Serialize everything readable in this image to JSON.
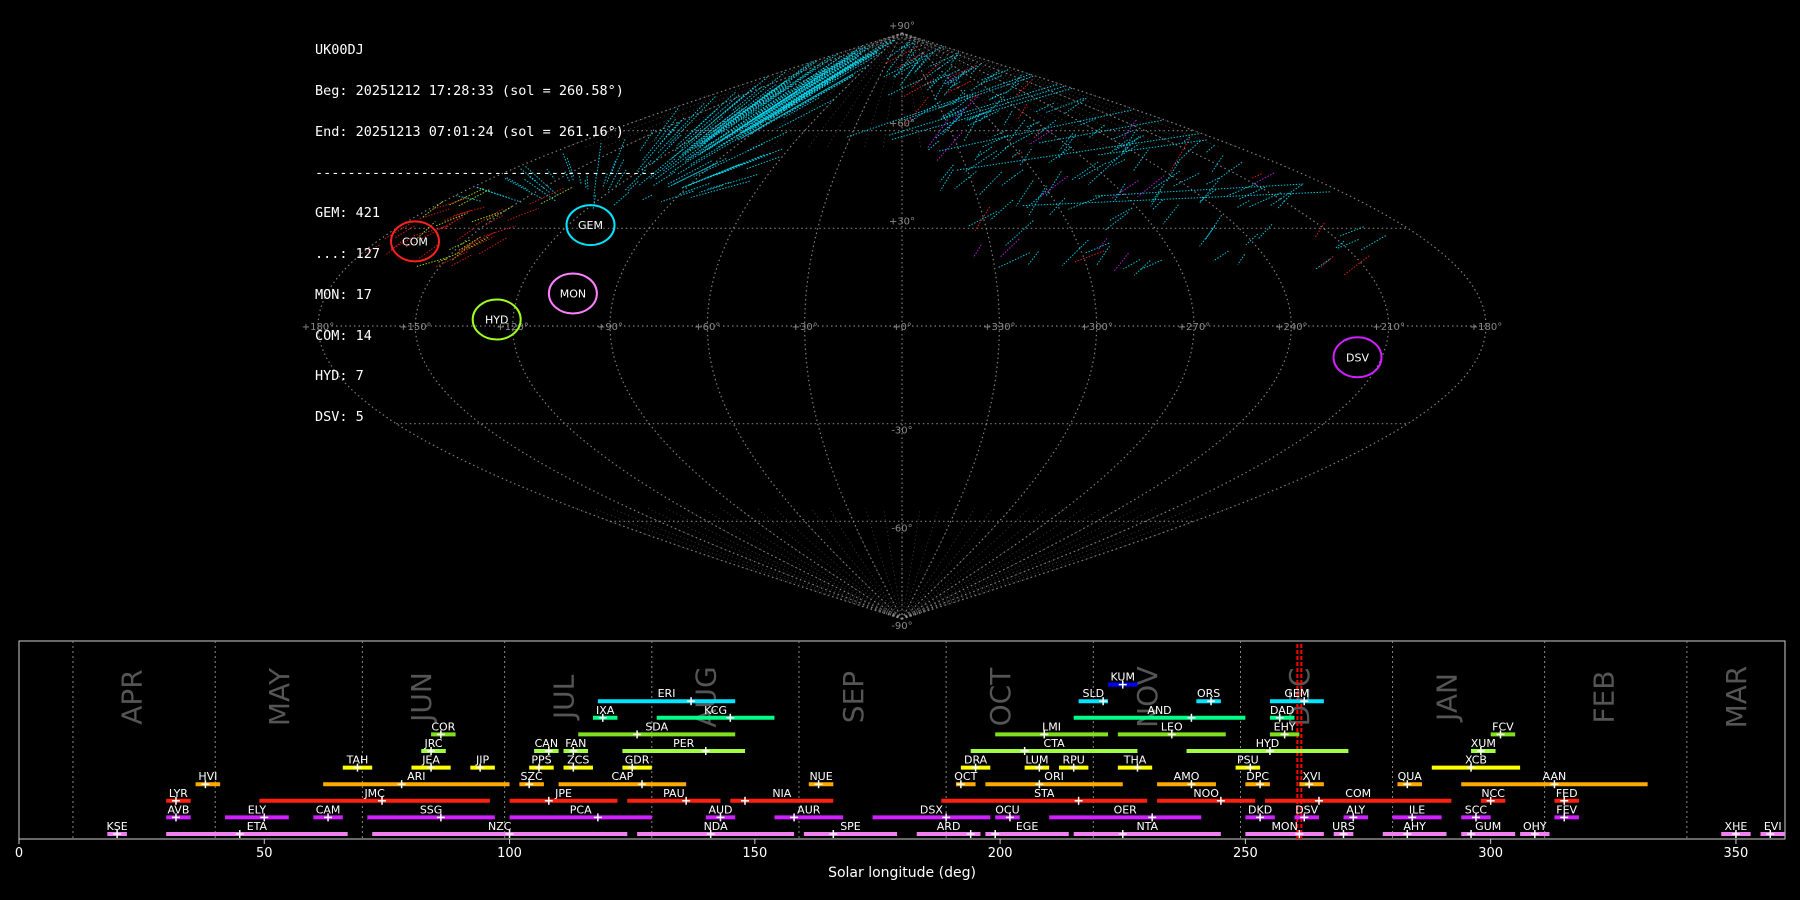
{
  "info": {
    "station": "UK00DJ",
    "begin": "Beg: 20251212 17:28:33 (sol = 260.58°)",
    "end": "End: 20251213 07:01:24 (sol = 261.16°)",
    "separator": "------------------------------------------",
    "counts": [
      "GEM: 421",
      "...: 127",
      "MON: 17",
      "COM: 14",
      "HYD: 7",
      "DSV: 5"
    ]
  },
  "colors": {
    "background": "#000000",
    "grid": "#9a9a9a",
    "sporadic": "#00e5ff",
    "marker": "#ff0000"
  },
  "chart_data": [
    {
      "type": "scatter",
      "projection": "sinusoidal",
      "ra_tick_labels": [
        "+180°",
        "+150°",
        "+120°",
        "+90°",
        "+60°",
        "+30°",
        "+0°",
        "+330°",
        "+300°",
        "+270°",
        "+240°",
        "+210°",
        "+180°"
      ],
      "dec_tick_labels": [
        "+90°",
        "+60°",
        "+30°",
        "-30°",
        "-60°",
        "-90°"
      ],
      "radiants": [
        {
          "name": "COM",
          "ra": 167,
          "dec": 26,
          "color": "#ff2020"
        },
        {
          "name": "GEM",
          "ra": 112,
          "dec": 31,
          "color": "#00e5ff"
        },
        {
          "name": "MON",
          "ra": 103,
          "dec": 10,
          "color": "#ff80ff"
        },
        {
          "name": "HYD",
          "ra": 125,
          "dec": 2,
          "color": "#a0ff20"
        },
        {
          "name": "DSV",
          "ra": 150,
          "dec": -3,
          "color": "#d020ff",
          "side": "right"
        }
      ]
    },
    {
      "type": "timeline",
      "xlabel": "Solar longitude (deg)",
      "xlim": [
        0,
        360
      ],
      "x_ticks": [
        0,
        50,
        100,
        150,
        200,
        250,
        300,
        350
      ],
      "current_sol": 261,
      "months": [
        {
          "name": "APR",
          "pos": 25
        },
        {
          "name": "MAY",
          "pos": 55
        },
        {
          "name": "JUN",
          "pos": 84
        },
        {
          "name": "JUL",
          "pos": 113
        },
        {
          "name": "AUG",
          "pos": 142
        },
        {
          "name": "SEP",
          "pos": 172
        },
        {
          "name": "OCT",
          "pos": 202
        },
        {
          "name": "NOV",
          "pos": 232
        },
        {
          "name": "DEC",
          "pos": 263
        },
        {
          "name": "JAN",
          "pos": 293
        },
        {
          "name": "FEB",
          "pos": 325
        },
        {
          "name": "MAR",
          "pos": 352
        }
      ],
      "month_dividers": [
        11,
        40,
        70,
        99,
        129,
        159,
        189,
        219,
        249,
        280,
        311,
        340
      ],
      "showers": [
        {
          "name": "KUM",
          "start": 222,
          "end": 228,
          "peak": 225,
          "row": 10,
          "color": "#0000ff"
        },
        {
          "name": "ERI",
          "start": 118,
          "end": 146,
          "peak": 137,
          "row": 9,
          "color": "#00e5ff"
        },
        {
          "name": "SLD",
          "start": 216,
          "end": 222,
          "peak": 221,
          "row": 9,
          "color": "#00e5ff"
        },
        {
          "name": "ORS",
          "start": 240,
          "end": 245,
          "peak": 243,
          "row": 9,
          "color": "#00e5ff"
        },
        {
          "name": "GEM",
          "start": 255,
          "end": 266,
          "peak": 262,
          "row": 9,
          "color": "#00e5ff"
        },
        {
          "name": "IXA",
          "start": 117,
          "end": 122,
          "peak": 119,
          "row": 8,
          "color": "#00ff88"
        },
        {
          "name": "KCG",
          "start": 130,
          "end": 154,
          "peak": 145,
          "row": 8,
          "color": "#00ff88"
        },
        {
          "name": "AND",
          "start": 215,
          "end": 250,
          "peak": 239,
          "row": 8,
          "color": "#00ff88"
        },
        {
          "name": "DAD",
          "start": 255,
          "end": 260,
          "peak": 257,
          "row": 8,
          "color": "#00ff88"
        },
        {
          "name": "COR",
          "start": 84,
          "end": 89,
          "peak": 86,
          "row": 7,
          "color": "#80e020"
        },
        {
          "name": "SDA",
          "start": 114,
          "end": 146,
          "peak": 126,
          "row": 7,
          "color": "#80e020"
        },
        {
          "name": "LMI",
          "start": 199,
          "end": 222,
          "peak": 209,
          "row": 7,
          "color": "#80e020"
        },
        {
          "name": "LEO",
          "start": 224,
          "end": 246,
          "peak": 235,
          "row": 7,
          "color": "#80e020"
        },
        {
          "name": "EHY",
          "start": 255,
          "end": 261,
          "peak": 258,
          "row": 7,
          "color": "#80e020"
        },
        {
          "name": "FCV",
          "start": 300,
          "end": 305,
          "peak": 302,
          "row": 7,
          "color": "#80e020"
        },
        {
          "name": "JRC",
          "start": 82,
          "end": 87,
          "peak": 84,
          "row": 6,
          "color": "#a0ff40"
        },
        {
          "name": "CAN",
          "start": 105,
          "end": 110,
          "peak": 108,
          "row": 6,
          "color": "#a0ff40"
        },
        {
          "name": "FAN",
          "start": 111,
          "end": 116,
          "peak": 113,
          "row": 6,
          "color": "#a0ff40"
        },
        {
          "name": "PER",
          "start": 123,
          "end": 148,
          "peak": 140,
          "row": 6,
          "color": "#a0ff40"
        },
        {
          "name": "CTA",
          "start": 194,
          "end": 228,
          "peak": 205,
          "row": 6,
          "color": "#a0ff40"
        },
        {
          "name": "HYD",
          "start": 238,
          "end": 271,
          "peak": 255,
          "row": 6,
          "color": "#a0ff40"
        },
        {
          "name": "XUM",
          "start": 296,
          "end": 301,
          "peak": 298,
          "row": 6,
          "color": "#a0ff40"
        },
        {
          "name": "TAH",
          "start": 66,
          "end": 72,
          "peak": 69,
          "row": 5,
          "color": "#ffff00"
        },
        {
          "name": "JEA",
          "start": 80,
          "end": 88,
          "peak": 84,
          "row": 5,
          "color": "#ffff00"
        },
        {
          "name": "JIP",
          "start": 92,
          "end": 97,
          "peak": 94,
          "row": 5,
          "color": "#ffff00"
        },
        {
          "name": "PPS",
          "start": 104,
          "end": 109,
          "peak": 106,
          "row": 5,
          "color": "#ffff00"
        },
        {
          "name": "ZCS",
          "start": 111,
          "end": 117,
          "peak": 113,
          "row": 5,
          "color": "#ffff00"
        },
        {
          "name": "GDR",
          "start": 123,
          "end": 129,
          "peak": 125,
          "row": 5,
          "color": "#ffff00"
        },
        {
          "name": "DRA",
          "start": 192,
          "end": 198,
          "peak": 195,
          "row": 5,
          "color": "#ffff00"
        },
        {
          "name": "LUM",
          "start": 205,
          "end": 210,
          "peak": 208,
          "row": 5,
          "color": "#ffff00"
        },
        {
          "name": "RPU",
          "start": 212,
          "end": 218,
          "peak": 215,
          "row": 5,
          "color": "#ffff00"
        },
        {
          "name": "THA",
          "start": 224,
          "end": 231,
          "peak": 228,
          "row": 5,
          "color": "#ffff00"
        },
        {
          "name": "PSU",
          "start": 248,
          "end": 253,
          "peak": 251,
          "row": 5,
          "color": "#ffff00"
        },
        {
          "name": "XCB",
          "start": 288,
          "end": 306,
          "peak": 296,
          "row": 5,
          "color": "#ffff00"
        },
        {
          "name": "HVI",
          "start": 36,
          "end": 41,
          "peak": 38,
          "row": 4,
          "color": "#ffaa00"
        },
        {
          "name": "ARI",
          "start": 62,
          "end": 100,
          "peak": 78,
          "row": 4,
          "color": "#ffaa00"
        },
        {
          "name": "SZC",
          "start": 102,
          "end": 107,
          "peak": 104,
          "row": 4,
          "color": "#ffaa00"
        },
        {
          "name": "CAP",
          "start": 110,
          "end": 136,
          "peak": 127,
          "row": 4,
          "color": "#ffaa00"
        },
        {
          "name": "NUE",
          "start": 161,
          "end": 166,
          "peak": 163,
          "row": 4,
          "color": "#ffaa00"
        },
        {
          "name": "OCT",
          "start": 191,
          "end": 195,
          "peak": 192,
          "row": 4,
          "color": "#ffaa00"
        },
        {
          "name": "ORI",
          "start": 197,
          "end": 225,
          "peak": 208,
          "row": 4,
          "color": "#ffaa00"
        },
        {
          "name": "AMO",
          "start": 232,
          "end": 244,
          "peak": 239,
          "row": 4,
          "color": "#ffaa00"
        },
        {
          "name": "DPC",
          "start": 250,
          "end": 255,
          "peak": 253,
          "row": 4,
          "color": "#ffaa00"
        },
        {
          "name": "XVI",
          "start": 261,
          "end": 266,
          "peak": 263,
          "row": 4,
          "color": "#ffaa00"
        },
        {
          "name": "QUA",
          "start": 281,
          "end": 286,
          "peak": 283,
          "row": 4,
          "color": "#ffaa00"
        },
        {
          "name": "AAN",
          "start": 294,
          "end": 332,
          "peak": 313,
          "row": 4,
          "color": "#ffaa00"
        },
        {
          "name": "LYR",
          "start": 30,
          "end": 35,
          "peak": 32,
          "row": 3,
          "color": "#ff2010"
        },
        {
          "name": "JMC",
          "start": 49,
          "end": 96,
          "peak": 74,
          "row": 3,
          "color": "#ff2010"
        },
        {
          "name": "JPE",
          "start": 100,
          "end": 122,
          "peak": 108,
          "row": 3,
          "color": "#ff2010"
        },
        {
          "name": "PAU",
          "start": 124,
          "end": 143,
          "peak": 136,
          "row": 3,
          "color": "#ff2010"
        },
        {
          "name": "NIA",
          "start": 145,
          "end": 166,
          "peak": 148,
          "row": 3,
          "color": "#ff2010"
        },
        {
          "name": "STA",
          "start": 188,
          "end": 230,
          "peak": 216,
          "row": 3,
          "color": "#ff2010"
        },
        {
          "name": "NOO",
          "start": 232,
          "end": 252,
          "peak": 245,
          "row": 3,
          "color": "#ff2010"
        },
        {
          "name": "COM",
          "start": 254,
          "end": 292,
          "peak": 265,
          "row": 3,
          "color": "#ff2010"
        },
        {
          "name": "NCC",
          "start": 298,
          "end": 303,
          "peak": 300,
          "row": 3,
          "color": "#ff2010"
        },
        {
          "name": "FED",
          "start": 313,
          "end": 318,
          "peak": 315,
          "row": 3,
          "color": "#ff2010"
        },
        {
          "name": "AVB",
          "start": 30,
          "end": 35,
          "peak": 32,
          "row": 2,
          "color": "#d020ff"
        },
        {
          "name": "ELY",
          "start": 42,
          "end": 55,
          "peak": 50,
          "row": 2,
          "color": "#d020ff"
        },
        {
          "name": "CAM",
          "start": 60,
          "end": 66,
          "peak": 63,
          "row": 2,
          "color": "#d020ff"
        },
        {
          "name": "SSG",
          "start": 71,
          "end": 97,
          "peak": 86,
          "row": 2,
          "color": "#d020ff"
        },
        {
          "name": "PCA",
          "start": 100,
          "end": 129,
          "peak": 118,
          "row": 2,
          "color": "#d020ff"
        },
        {
          "name": "AUD",
          "start": 140,
          "end": 146,
          "peak": 143,
          "row": 2,
          "color": "#d020ff"
        },
        {
          "name": "AUR",
          "start": 154,
          "end": 168,
          "peak": 158,
          "row": 2,
          "color": "#d020ff"
        },
        {
          "name": "DSX",
          "start": 174,
          "end": 198,
          "peak": 189,
          "row": 2,
          "color": "#d020ff"
        },
        {
          "name": "OCU",
          "start": 199,
          "end": 204,
          "peak": 202,
          "row": 2,
          "color": "#d020ff"
        },
        {
          "name": "OER",
          "start": 210,
          "end": 241,
          "peak": 231,
          "row": 2,
          "color": "#d020ff"
        },
        {
          "name": "DKD",
          "start": 250,
          "end": 256,
          "peak": 253,
          "row": 2,
          "color": "#d020ff"
        },
        {
          "name": "DSV",
          "start": 260,
          "end": 265,
          "peak": 262,
          "row": 2,
          "color": "#d020ff"
        },
        {
          "name": "ALY",
          "start": 270,
          "end": 275,
          "peak": 272,
          "row": 2,
          "color": "#d020ff"
        },
        {
          "name": "ILE",
          "start": 280,
          "end": 290,
          "peak": 284,
          "row": 2,
          "color": "#d020ff"
        },
        {
          "name": "SCC",
          "start": 294,
          "end": 300,
          "peak": 297,
          "row": 2,
          "color": "#d020ff"
        },
        {
          "name": "FEV",
          "start": 313,
          "end": 318,
          "peak": 315,
          "row": 2,
          "color": "#d020ff"
        },
        {
          "name": "KSE",
          "start": 18,
          "end": 22,
          "peak": 20,
          "row": 1,
          "color": "#f080f0"
        },
        {
          "name": "ETA",
          "start": 30,
          "end": 67,
          "peak": 45,
          "row": 1,
          "color": "#f080f0"
        },
        {
          "name": "NZC",
          "start": 72,
          "end": 124,
          "peak": 100,
          "row": 1,
          "color": "#f080f0"
        },
        {
          "name": "NDA",
          "start": 126,
          "end": 158,
          "peak": 141,
          "row": 1,
          "color": "#f080f0"
        },
        {
          "name": "SPE",
          "start": 160,
          "end": 179,
          "peak": 166,
          "row": 1,
          "color": "#f080f0"
        },
        {
          "name": "ARD",
          "start": 183,
          "end": 196,
          "peak": 194,
          "row": 1,
          "color": "#f080f0"
        },
        {
          "name": "EGE",
          "start": 197,
          "end": 214,
          "peak": 199,
          "row": 1,
          "color": "#f080f0"
        },
        {
          "name": "NTA",
          "start": 215,
          "end": 245,
          "peak": 225,
          "row": 1,
          "color": "#f080f0"
        },
        {
          "name": "MON",
          "start": 250,
          "end": 266,
          "peak": 261,
          "row": 1,
          "color": "#f080f0"
        },
        {
          "name": "URS",
          "start": 268,
          "end": 272,
          "peak": 270,
          "row": 1,
          "color": "#f080f0"
        },
        {
          "name": "AHY",
          "start": 278,
          "end": 291,
          "peak": 283,
          "row": 1,
          "color": "#f080f0"
        },
        {
          "name": "GUM",
          "start": 294,
          "end": 305,
          "peak": 296,
          "row": 1,
          "color": "#f080f0"
        },
        {
          "name": "OHY",
          "start": 306,
          "end": 312,
          "peak": 309,
          "row": 1,
          "color": "#f080f0"
        },
        {
          "name": "XHE",
          "start": 347,
          "end": 353,
          "peak": 350,
          "row": 1,
          "color": "#f080f0"
        },
        {
          "name": "EVI",
          "start": 355,
          "end": 360,
          "peak": 357,
          "row": 1,
          "color": "#f080f0"
        }
      ]
    }
  ]
}
